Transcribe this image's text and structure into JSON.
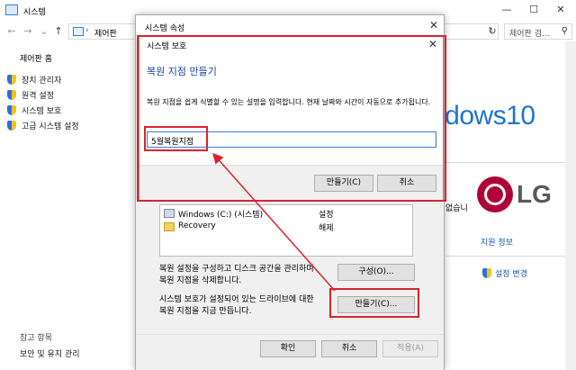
{
  "system_window": {
    "title": "시스템",
    "window_controls": {
      "minimize": "—",
      "maximize": "☐",
      "close": "✕"
    },
    "breadcrumb": {
      "path_item": "제어판",
      "separator": "›"
    },
    "search_placeholder": "제어판 검...",
    "sidebar": {
      "home": "제어판 홈",
      "items": [
        {
          "label": "장치 관리자",
          "icon": "shield-icon"
        },
        {
          "label": "원격 설정",
          "icon": "shield-icon"
        },
        {
          "label": "시스템 보호",
          "icon": "shield-icon"
        },
        {
          "label": "고급 시스템 설정",
          "icon": "shield-icon"
        }
      ],
      "see_also": "참고 항목",
      "security_link": "보안 및 유지 관리"
    },
    "brand_text": "ndows10",
    "oem_logo_text": "LG",
    "partial_text": "없습니",
    "support_info": "지원 정보",
    "change_settings": "설정 변경"
  },
  "system_properties": {
    "title": "시스템 속성",
    "drives": [
      {
        "name": "Windows (C:) (시스템)",
        "state": "설정",
        "icon": "drive-icon"
      },
      {
        "name": "Recovery",
        "state": "해제",
        "icon": "folder-icon"
      }
    ],
    "configure_text": [
      "복원 설정을 구성하고 디스크 공간을 관리하며",
      "복원 지점을 삭제합니다."
    ],
    "configure_button": "구성(O)...",
    "create_text": [
      "시스템 보호가 설정되어 있는 드라이브에 대한",
      "복원 지점을 지금 만듭니다."
    ],
    "create_button": "만들기(C)...",
    "ok_button": "확인",
    "cancel_button": "취소",
    "apply_button": "적용(A)"
  },
  "restore_dialog": {
    "title": "시스템 보호",
    "heading": "복원 지점 만들기",
    "description": "복원 지점을 쉽게 식별할 수 있는 설명을 입력합니다. 현재 날짜와 시간이 자동으로 추가됩니다.",
    "input_value": "5월복원지점",
    "create_button": "만들기(C)",
    "cancel_button": "취소"
  },
  "colors": {
    "annotation": "#d9242f",
    "accent": "#1e74d6",
    "link": "#1a56b0"
  }
}
